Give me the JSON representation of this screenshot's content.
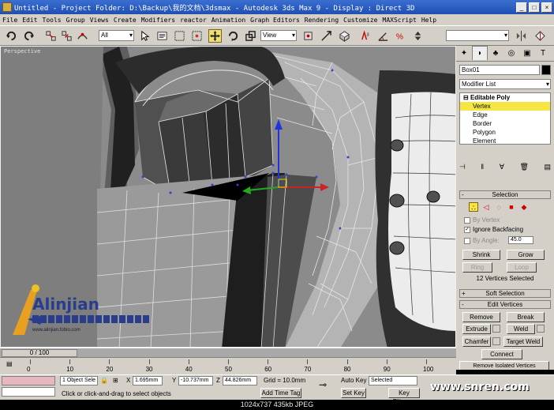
{
  "window": {
    "title": "Untitled   - Project Folder: D:\\Backup\\我的文档\\3dsmax   - Autodesk 3ds Max 9   - Display : Direct 3D",
    "minimize": "_",
    "maximize": "□",
    "close": "×"
  },
  "menu": [
    "File",
    "Edit",
    "Tools",
    "Group",
    "Views",
    "Create",
    "Modifiers",
    "reactor",
    "Animation",
    "Graph Editors",
    "Rendering",
    "Customize",
    "MAXScript",
    "Help"
  ],
  "toolbar": {
    "selection_filter": "All",
    "ref_coord": "View",
    "named_selection": ""
  },
  "viewport": {
    "label": "Perspective"
  },
  "logo": {
    "brand": "Alinjian",
    "url": "www.alinjian.fobio.com"
  },
  "command_panel": {
    "object_name": "Box01",
    "modifier_list": "Modifier List",
    "stack": {
      "header": "Editable Poly",
      "items": [
        "Vertex",
        "Edge",
        "Border",
        "Polygon",
        "Element"
      ],
      "selected": "Vertex"
    },
    "selection": {
      "title": "Selection",
      "by_vertex": "By Vertex",
      "ignore_backfacing": "Ignore Backfacing",
      "by_angle": "By Angle:",
      "angle_value": "45.0",
      "shrink": "Shrink",
      "grow": "Grow",
      "ring": "Ring",
      "loop": "Loop",
      "status": "12 Vertices Selected"
    },
    "soft_selection": "Soft Selection",
    "edit_vertices": {
      "title": "Edit Vertices",
      "remove": "Remove",
      "break": "Break",
      "extrude": "Extrude",
      "weld": "Weld",
      "chamfer": "Chamfer",
      "target_weld": "Target Weld",
      "connect": "Connect",
      "remove_isolated": "Remove Isolated Vertices"
    }
  },
  "timeline": {
    "slider_label": "0 / 100",
    "ticks": [
      "0",
      "10",
      "20",
      "30",
      "40",
      "50",
      "60",
      "70",
      "80",
      "90",
      "100"
    ]
  },
  "status": {
    "selection_count": "1 Object Sele",
    "x_label": "X",
    "x_value": "1.695mm",
    "y_label": "Y",
    "y_value": "-10.737mm",
    "z_label": "Z",
    "z_value": "44.826mm",
    "grid": "Grid = 10.0mm",
    "prompt": "Click or click-and-drag to select objects",
    "add_time_tag": "Add Time Tag",
    "auto_key": "Auto Key",
    "set_key": "Set Key",
    "key_mode": "Selected",
    "key_filters": "Key Filters..."
  },
  "watermark": "www.snren.com",
  "image_info": "1024x737  435kb  JPEG"
}
